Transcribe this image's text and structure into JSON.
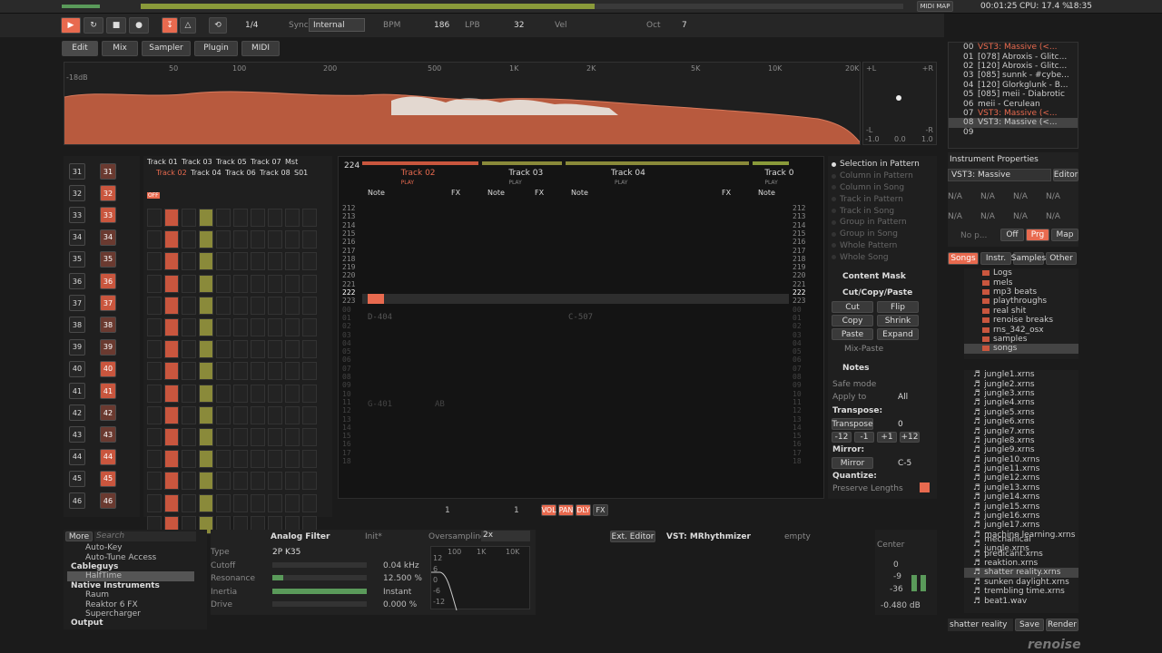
{
  "topbar": {
    "midi_map": "MIDI MAP",
    "time": "00:01:25",
    "cpu": "CPU: 17.4 %",
    "clock": "18:35",
    "screens": [
      "1",
      "2",
      "3",
      "4",
      "5",
      "6"
    ]
  },
  "transport": {
    "pattern_step": "1/4",
    "sync_label": "Sync",
    "sync_value": "Internal",
    "bpm_label": "BPM",
    "bpm_value": "186",
    "lpb_label": "LPB",
    "lpb_value": "32",
    "vel_label": "Vel",
    "oct_label": "Oct",
    "oct_value": "7"
  },
  "tabs": {
    "edit": "Edit",
    "mix": "Mix",
    "sampler": "Sampler",
    "plugin": "Plugin",
    "midi": "MIDI"
  },
  "spectrum": {
    "db": "-18dB",
    "freqs": [
      "50",
      "100",
      "200",
      "500",
      "1K",
      "2K",
      "5K",
      "10K",
      "20K"
    ],
    "scope_l": "+L",
    "scope_r": "+R",
    "scope_ml": "-L",
    "scope_mr": "-R",
    "scope_b1": "-1.0",
    "scope_b2": "0.0",
    "scope_b3": "1.0"
  },
  "instruments": {
    "list": [
      {
        "n": "00",
        "name": "VST3: Massive (<..."
      },
      {
        "n": "01",
        "name": "[078] Abroxis - Glitc..."
      },
      {
        "n": "02",
        "name": "[120] Abroxis - Glitc..."
      },
      {
        "n": "03",
        "name": "[085] sunnk - #cybe..."
      },
      {
        "n": "04",
        "name": "[120] Glorkglunk - B..."
      },
      {
        "n": "05",
        "name": "[085] meii - Diabrotic"
      },
      {
        "n": "06",
        "name": "meii - Cerulean"
      },
      {
        "n": "07",
        "name": "VST3: Massive (<..."
      },
      {
        "n": "08",
        "name": "VST3: Massive (<..."
      },
      {
        "n": "09",
        "name": ""
      }
    ],
    "props_title": "Instrument Properties",
    "props_plugin": "VST3: Massive",
    "props_editor": "Editor",
    "na": [
      "N/A",
      "N/A",
      "N/A",
      "N/A",
      "N/A",
      "N/A",
      "N/A",
      "N/A"
    ],
    "no_prg": "No p...",
    "off": "Off",
    "prg": "Prg",
    "map": "Map"
  },
  "browser": {
    "tabs": [
      "Songs",
      "Instr.",
      "Samples",
      "Other"
    ],
    "folders": [
      "Logs",
      "mels",
      "mp3 beats",
      "playthroughs",
      "real shit",
      "renoise breaks",
      "rns_342_osx",
      "samples",
      "songs"
    ],
    "files": [
      "jungle1.xrns",
      "jungle2.xrns",
      "jungle3.xrns",
      "jungle4.xrns",
      "jungle5.xrns",
      "jungle6.xrns",
      "jungle7.xrns",
      "jungle8.xrns",
      "jungle9.xrns",
      "jungle10.xrns",
      "jungle11.xrns",
      "jungle12.xrns",
      "jungle13.xrns",
      "jungle14.xrns",
      "jungle15.xrns",
      "jungle16.xrns",
      "jungle17.xrns",
      "machine learning.xrns",
      "mechanical jungle.xrns",
      "predicant.xrns",
      "reaktion.xrns",
      "shatter reality.xrns",
      "sunken daylight.xrns",
      "trembling time.xrns",
      "beat1.wav"
    ],
    "filename": "shatter reality",
    "save": "Save",
    "render": "Render"
  },
  "seq": {
    "rows": [
      "31",
      "32",
      "33",
      "34",
      "35",
      "36",
      "37",
      "38",
      "39",
      "40",
      "41",
      "42",
      "43",
      "44",
      "45",
      "46"
    ],
    "pats": [
      "31",
      "32",
      "33",
      "34",
      "35",
      "36",
      "37",
      "38",
      "39",
      "40",
      "41",
      "42",
      "43",
      "44",
      "45",
      "46"
    ]
  },
  "matrix": {
    "tracks_top": [
      "Track 01",
      "Track 03",
      "Track 05",
      "Track 07",
      "Mst"
    ],
    "tracks_bottom": [
      "Track 02",
      "Track 04",
      "Track 06",
      "Track 08",
      "S01"
    ],
    "off": "OFF",
    "play": "PLAY"
  },
  "pattern": {
    "header_num": "224",
    "tracks": [
      "Track 02",
      "Track 03",
      "Track 04",
      "Track 0"
    ],
    "note": "Note",
    "fx": "FX",
    "play": "PLAY",
    "lines": [
      "212",
      "213",
      "214",
      "215",
      "216",
      "217",
      "218",
      "219",
      "220",
      "221",
      "222",
      "223",
      "00",
      "01",
      "02",
      "03",
      "04",
      "05",
      "06",
      "07",
      "08",
      "09",
      "10",
      "11",
      "12",
      "13",
      "14",
      "15",
      "16",
      "17",
      "18"
    ],
    "n1": "D-404",
    "n2": "C-507",
    "n3": "G-401",
    "n4": "AB"
  },
  "scope_panel": {
    "options": [
      "Selection in Pattern",
      "Column in Pattern",
      "Column in Song",
      "Track in Pattern",
      "Track in Song",
      "Group in Pattern",
      "Group in Song",
      "Whole Pattern",
      "Whole Song"
    ],
    "content_mask": "Content Mask",
    "ccp": "Cut/Copy/Paste",
    "cut": "Cut",
    "flip": "Flip",
    "copy": "Copy",
    "shrink": "Shrink",
    "paste": "Paste",
    "expand": "Expand",
    "mix_paste": "Mix-Paste",
    "notes": "Notes",
    "safe_mode": "Safe mode",
    "apply_to": "Apply to",
    "all": "All",
    "transpose_h": "Transpose:",
    "transpose": "Transpose",
    "tval": "0",
    "m12": "-12",
    "m1": "-1",
    "p1": "+1",
    "p12": "+12",
    "mirror_h": "Mirror:",
    "mirror": "Mirror",
    "mval": "C-5",
    "quant_h": "Quantize:",
    "preserve": "Preserve Lengths"
  },
  "pattern_toolbar": {
    "step": "1",
    "lines": "1",
    "vol": "VOL",
    "pan": "PAN",
    "dly": "DLY",
    "fx": "FX"
  },
  "dsp": {
    "more": "More",
    "search": "Search",
    "items": [
      {
        "t": "Auto-Key",
        "l": 2
      },
      {
        "t": "Auto-Tune Access",
        "l": 2
      },
      {
        "t": "Cableguys",
        "l": 1
      },
      {
        "t": "HalfTime",
        "l": 2,
        "sel": true
      },
      {
        "t": "Native Instruments",
        "l": 1
      },
      {
        "t": "Raum",
        "l": 2
      },
      {
        "t": "Reaktor 6 FX",
        "l": 2
      },
      {
        "t": "Supercharger",
        "l": 2
      },
      {
        "t": "Output",
        "l": 1
      }
    ],
    "device": "Analog Filter",
    "preset": "Init*",
    "type": "Type",
    "type_val": "2P K35",
    "cutoff": "Cutoff",
    "cutoff_val": "0.04 kHz",
    "reso": "Resonance",
    "reso_val": "12.500 %",
    "inertia": "Inertia",
    "inertia_val": "Instant",
    "drive": "Drive",
    "drive_val": "0.000 %",
    "oversampling": "Oversampling",
    "ovs_val": "2x",
    "eq_freqs": [
      "100",
      "1K",
      "10K"
    ],
    "eq_db": [
      "12",
      "6",
      "0",
      "-6",
      "-12"
    ],
    "ext": "Ext. Editor",
    "vst": "VST: MRhythmizer",
    "empty": "empty",
    "center": "Center",
    "meter": [
      "0",
      "-9",
      "-36"
    ],
    "meter_val": "-0.480 dB"
  },
  "footer": {
    "logo": "renoise"
  }
}
